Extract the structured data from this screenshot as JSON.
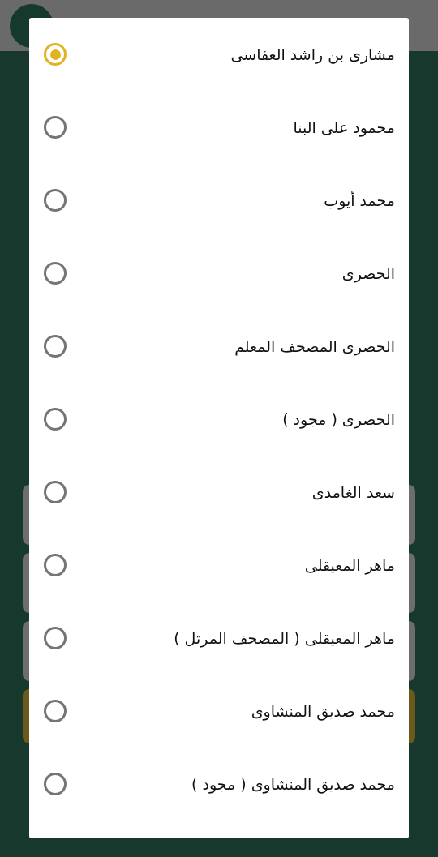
{
  "dialog": {
    "options": [
      {
        "label": "مشارى بن راشد العفاسى",
        "selected": true
      },
      {
        "label": "محمود على البنا",
        "selected": false
      },
      {
        "label": "محمد أيوب",
        "selected": false
      },
      {
        "label": "الحصرى",
        "selected": false
      },
      {
        "label": "الحصرى المصحف المعلم",
        "selected": false
      },
      {
        "label": "الحصرى ( مجود )",
        "selected": false
      },
      {
        "label": "سعد الغامدى",
        "selected": false
      },
      {
        "label": "ماهر المعيقلى",
        "selected": false
      },
      {
        "label": "ماهر المعيقلى ( المصحف المرتل )",
        "selected": false
      },
      {
        "label": "محمد صديق المنشاوى",
        "selected": false
      },
      {
        "label": "محمد صديق المنشاوى ( مجود )",
        "selected": false
      }
    ]
  }
}
